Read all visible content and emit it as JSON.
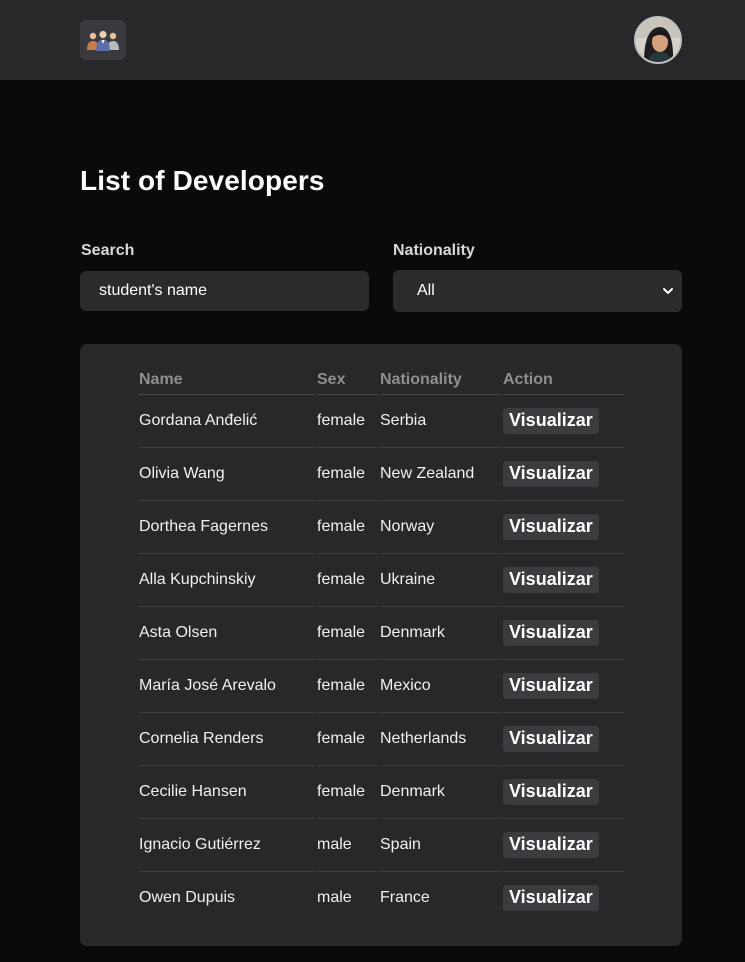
{
  "header": {
    "logo_icon": "team-icon",
    "avatar": "user-avatar"
  },
  "page": {
    "title": "List of Developers"
  },
  "filters": {
    "search_label": "Search",
    "search_value": "student's name",
    "nationality_label": "Nationality",
    "nationality_value": "All",
    "dropdown_icon": "chevron-down-icon"
  },
  "table": {
    "headers": {
      "name": "Name",
      "sex": "Sex",
      "nationality": "Nationality",
      "action": "Action"
    },
    "rows": [
      {
        "name": "Gordana Anđelić",
        "sex": "female",
        "nationality": "Serbia",
        "action": "Visualizar"
      },
      {
        "name": "Olivia Wang",
        "sex": "female",
        "nationality": "New Zealand",
        "action": "Visualizar"
      },
      {
        "name": "Dorthea Fagernes",
        "sex": "female",
        "nationality": "Norway",
        "action": "Visualizar"
      },
      {
        "name": "Alla Kupchinskiy",
        "sex": "female",
        "nationality": "Ukraine",
        "action": "Visualizar"
      },
      {
        "name": "Asta Olsen",
        "sex": "female",
        "nationality": "Denmark",
        "action": "Visualizar"
      },
      {
        "name": "María José Arevalo",
        "sex": "female",
        "nationality": "Mexico",
        "action": "Visualizar"
      },
      {
        "name": "Cornelia Renders",
        "sex": "female",
        "nationality": "Netherlands",
        "action": "Visualizar"
      },
      {
        "name": "Cecilie Hansen",
        "sex": "female",
        "nationality": "Denmark",
        "action": "Visualizar"
      },
      {
        "name": "Ignacio Gutiérrez",
        "sex": "male",
        "nationality": "Spain",
        "action": "Visualizar"
      },
      {
        "name": "Owen Dupuis",
        "sex": "male",
        "nationality": "France",
        "action": "Visualizar"
      }
    ]
  },
  "colors": {
    "background": "#0a0a0b",
    "header_bg": "#28282b",
    "card_bg": "#28282b",
    "input_bg": "#2b2b2e",
    "button_bg": "#3c3c40",
    "header_text": "#8e8e93"
  }
}
